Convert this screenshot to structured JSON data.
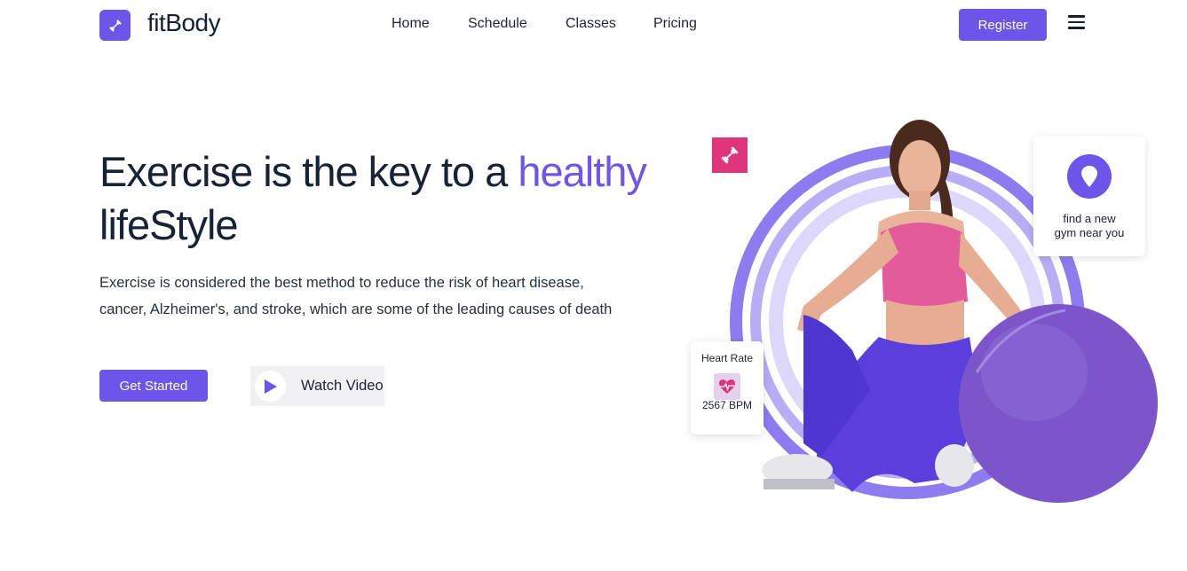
{
  "brand": {
    "name": "fitBody",
    "logo_icon": "dumbbell-icon",
    "accent": "#6c55e8"
  },
  "nav": {
    "items": [
      {
        "label": "Home"
      },
      {
        "label": "Schedule"
      },
      {
        "label": "Classes"
      },
      {
        "label": "Pricing"
      }
    ],
    "register_label": "Register",
    "menu_icon": "hamburger-icon"
  },
  "hero": {
    "title_part1": "Exercise is the key to a ",
    "title_accent": "healthy",
    "title_part2": "lifeStyle",
    "description_line1": "Exercise is considered the best method to reduce the risk of heart disease,",
    "description_line2": "cancer, Alzheimer's, and stroke, which are some of the leading causes of death",
    "cta_label": "Get Started",
    "video_label": "Watch Video",
    "video_icon": "play-icon"
  },
  "cards": {
    "heart_rate": {
      "title": "Heart Rate",
      "value": "2567 BPM",
      "icon": "heart-pulse-icon"
    },
    "gym": {
      "line1": "find a new",
      "line2": "gym near you",
      "icon": "location-pin-icon"
    }
  },
  "colors": {
    "primary": "#6c55e8",
    "heading": "#162236",
    "pink_badge": "#e0357a",
    "ring_outer": "#8c7cf0",
    "ring_middle": "#b8adf6",
    "ring_inner": "#ddd8fb"
  }
}
